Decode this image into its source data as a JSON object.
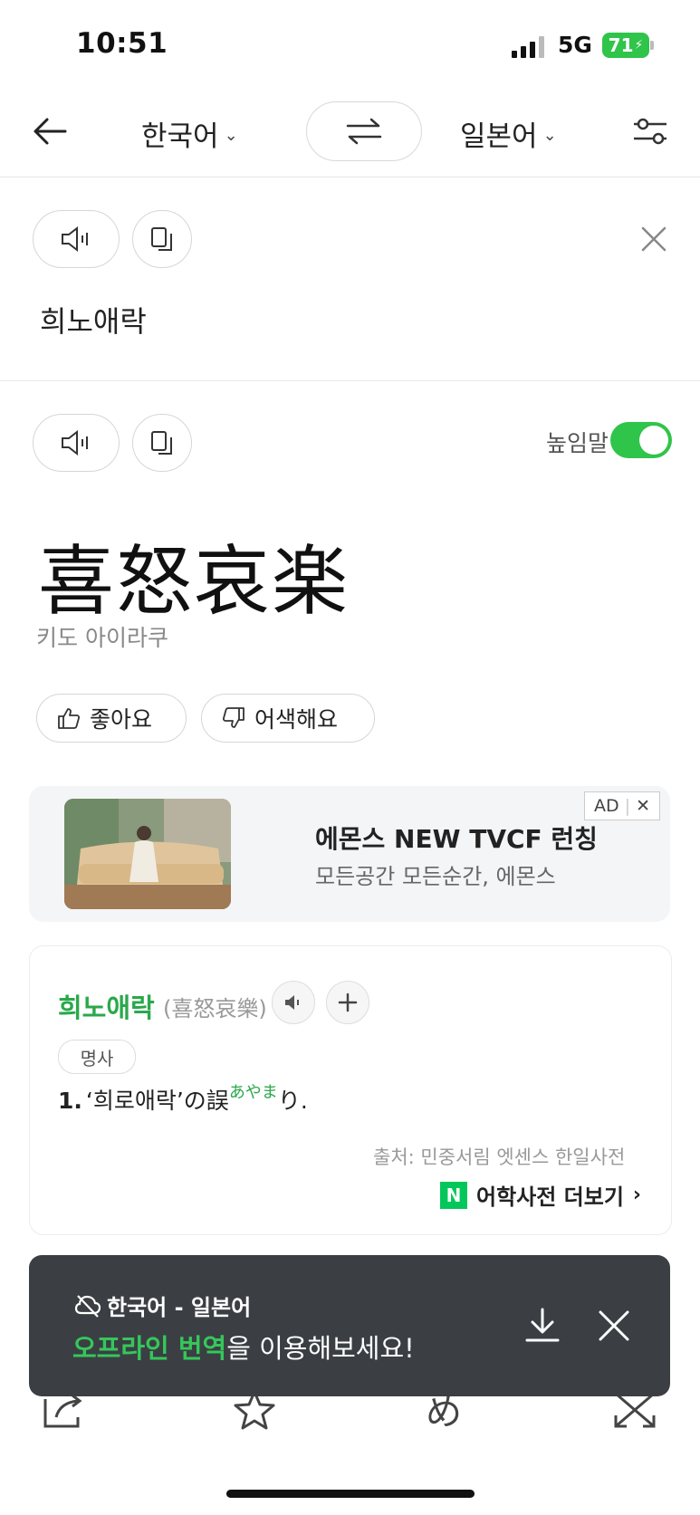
{
  "status_bar": {
    "time": "10:51",
    "network": "5G",
    "battery": "71"
  },
  "nav": {
    "source_lang": "한국어",
    "target_lang": "일본어"
  },
  "input": {
    "text": "희노애락"
  },
  "output": {
    "honorific_label": "높임말",
    "honorific_on": true,
    "text": "喜怒哀楽",
    "reading": "키도 아이라쿠",
    "like_label": "좋아요",
    "dislike_label": "어색해요"
  },
  "ad": {
    "badge": "AD",
    "title": "에몬스 NEW TVCF 런칭",
    "subtitle": "모든공간 모든순간, 에몬스"
  },
  "dictionary": {
    "word": "희노애락",
    "hanja": "(喜怒哀樂)",
    "pos": "명사",
    "def_number": "1.",
    "def_text": "‘희로애락’の誤",
    "def_ruby": "あやま",
    "def_tail": "り.",
    "source": "출처: 민중서림 엣센스 한일사전",
    "more_badge": "N",
    "more_label": "어학사전 더보기"
  },
  "toast": {
    "line1": "한국어 - 일본어",
    "highlight": "오프라인 번역",
    "rest": "을 이용해보세요!"
  },
  "colors": {
    "accent": "#2fc44a",
    "link_green": "#2aa84a",
    "toast_bg": "#3b3f44"
  }
}
